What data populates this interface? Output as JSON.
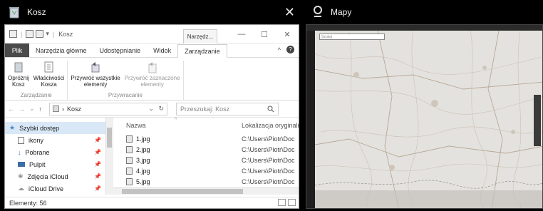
{
  "left_caption": {
    "title": "Kosz",
    "close": "✕"
  },
  "right_caption": {
    "title": "Mapy"
  },
  "explorer": {
    "window_title": "Kosz",
    "context_tab": "Narzędz...",
    "tabs": [
      "Plik",
      "Narzędzia główne",
      "Udostępnianie",
      "Widok",
      "Zarządzanie"
    ],
    "ribbon": {
      "groups": [
        {
          "label": "Zarządzanie",
          "buttons": [
            "Opróżnij\nKosz",
            "Właściwości\nKosza"
          ]
        },
        {
          "label": "Przywracanie",
          "buttons": [
            "Przywróć wszystkie\nelementy",
            "Przywróć zaznaczone\nelementy"
          ]
        }
      ]
    },
    "address": {
      "path": "Kosz",
      "search_placeholder": "Przeszukaj: Kosz"
    },
    "nav": [
      {
        "label": "Szybki dostęp"
      },
      {
        "label": "ikony"
      },
      {
        "label": "Pobrane"
      },
      {
        "label": "Pulpit"
      },
      {
        "label": "Zdjęcia iCloud"
      },
      {
        "label": "iCloud Drive"
      }
    ],
    "columns": {
      "name": "Nazwa",
      "location": "Lokalizacja oryginalna"
    },
    "files": [
      {
        "name": "1.jpg",
        "location": "C:\\Users\\Piotr\\Doc"
      },
      {
        "name": "2.jpg",
        "location": "C:\\Users\\Piotr\\Doc"
      },
      {
        "name": "3.jpg",
        "location": "C:\\Users\\Piotr\\Doc"
      },
      {
        "name": "4.jpg",
        "location": "C:\\Users\\Piotr\\Doc"
      },
      {
        "name": "5.jpg",
        "location": "C:\\Users\\Piotr\\Doc"
      }
    ],
    "status": "Elementy: 56"
  },
  "maps": {
    "search_placeholder": "Szukaj"
  }
}
